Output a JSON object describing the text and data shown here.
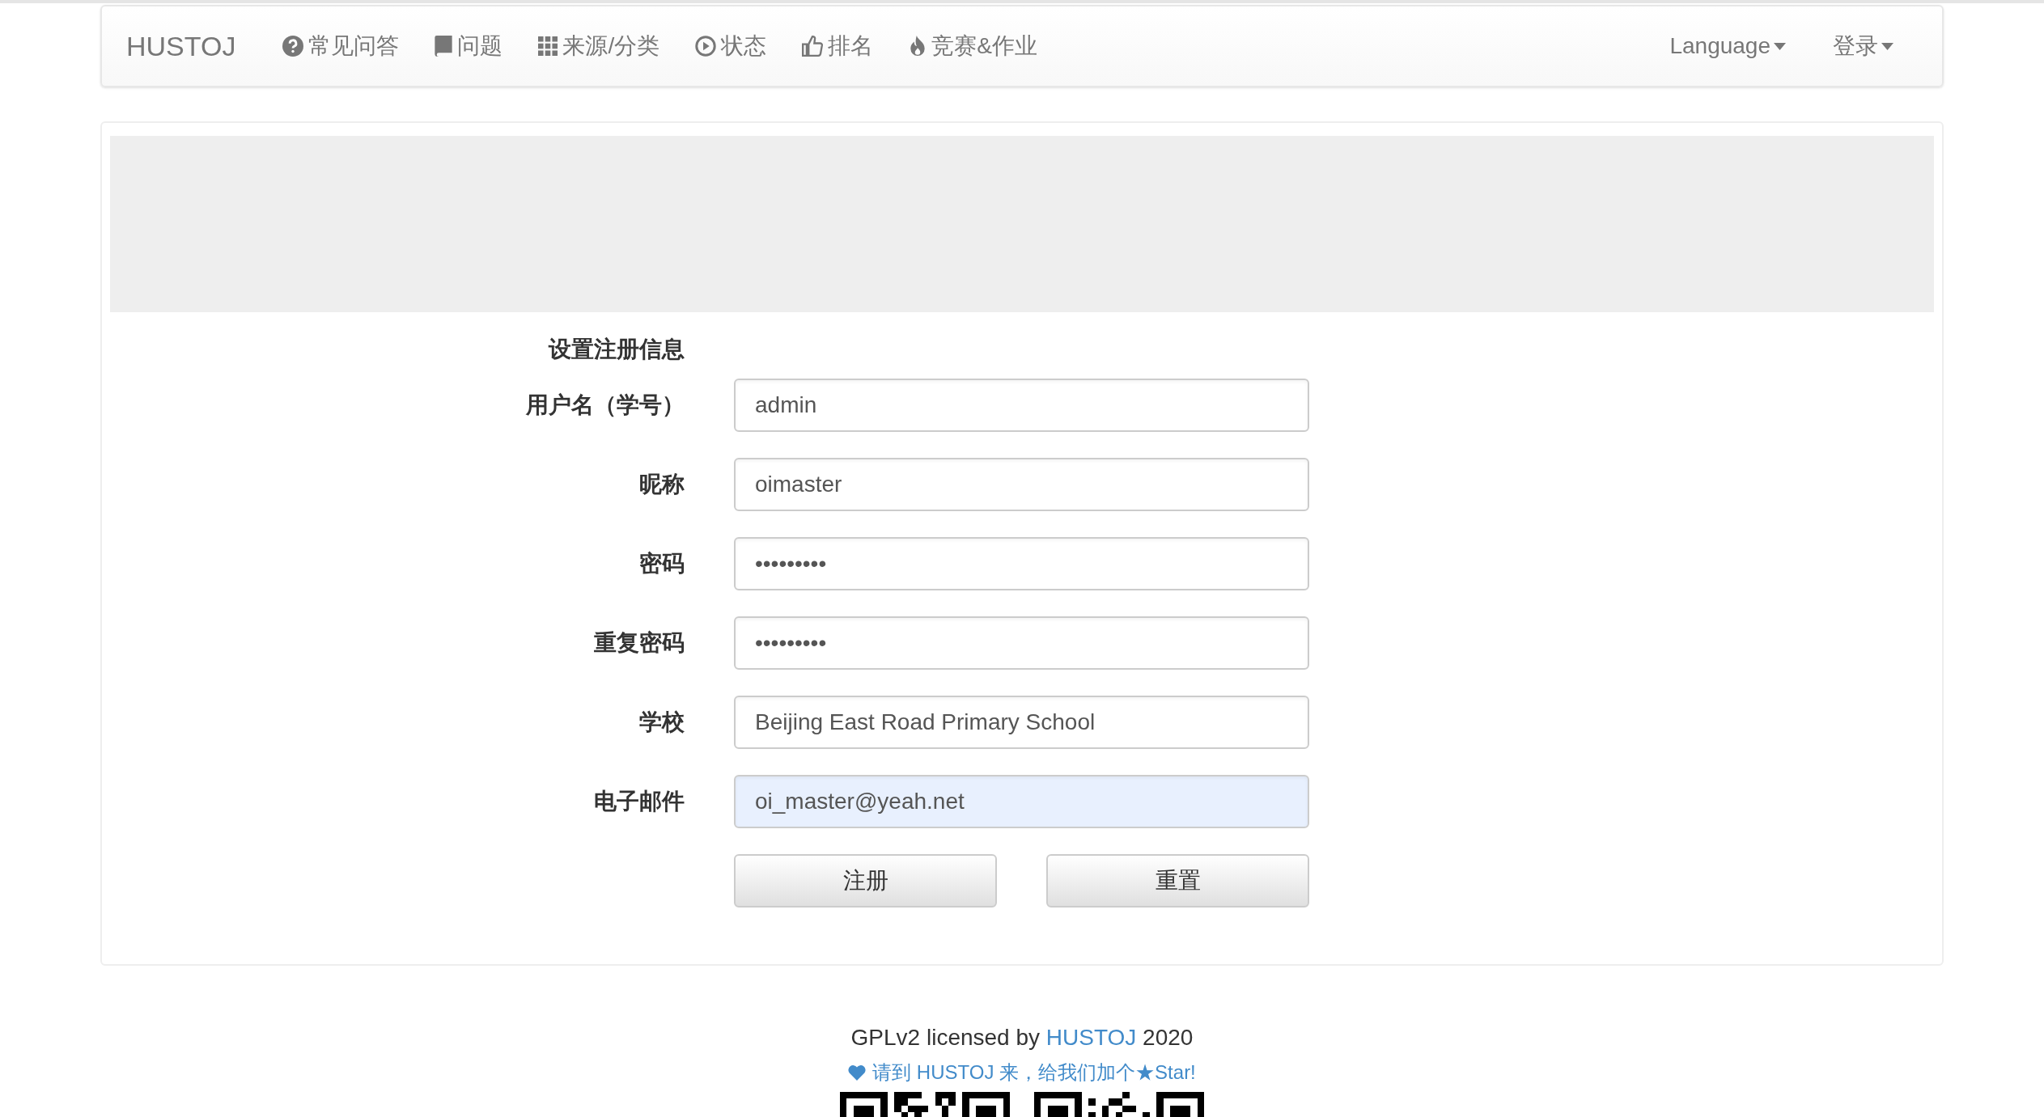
{
  "navbar": {
    "brand": "HUSTOJ",
    "items": [
      {
        "label": "常见问答"
      },
      {
        "label": "问题"
      },
      {
        "label": "来源/分类"
      },
      {
        "label": "状态"
      },
      {
        "label": "排名"
      },
      {
        "label": "竞赛&作业"
      }
    ],
    "right": [
      {
        "label": "Language"
      },
      {
        "label": "登录"
      }
    ]
  },
  "form": {
    "title": "设置注册信息",
    "fields": [
      {
        "label": "用户名（学号）",
        "value": "admin",
        "highlighted": false
      },
      {
        "label": "昵称",
        "value": "oimaster",
        "highlighted": false
      },
      {
        "label": "密码",
        "value": "•••••••••",
        "highlighted": false
      },
      {
        "label": "重复密码",
        "value": "•••••••••",
        "highlighted": false
      },
      {
        "label": "学校",
        "value": "Beijing East Road Primary School",
        "highlighted": false
      },
      {
        "label": "电子邮件",
        "value": "oi_master@yeah.net",
        "highlighted": true
      }
    ],
    "buttons": [
      "注册",
      "重置"
    ]
  },
  "footer": {
    "license_prefix": "GPLv2 licensed by",
    "license_link": "HUSTOJ",
    "license_year": "2020",
    "star_text": "请到 HUSTOJ 来，给我们加个★Star!"
  }
}
